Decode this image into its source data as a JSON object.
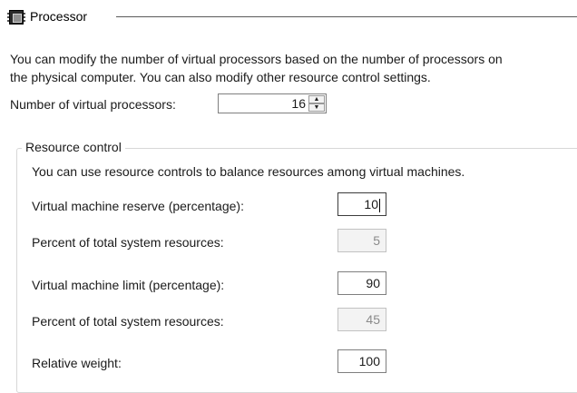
{
  "header": {
    "title": "Processor",
    "icon": "processor-chip-icon"
  },
  "description": {
    "line1": "You can modify the number of virtual processors based on the number of processors on",
    "line2": "the physical computer. You can also modify other resource control settings."
  },
  "virtual_processors": {
    "label": "Number of virtual processors:",
    "value": "16"
  },
  "resource_control": {
    "title": "Resource control",
    "description": "You can use resource controls to balance resources among virtual machines.",
    "reserve_label": "Virtual machine reserve (percentage):",
    "reserve_value": "10",
    "reserve_total_label": "Percent of total system resources:",
    "reserve_total_value": "5",
    "limit_label": "Virtual machine limit (percentage):",
    "limit_value": "90",
    "limit_total_label": "Percent of total system resources:",
    "limit_total_value": "45",
    "weight_label": "Relative weight:",
    "weight_value": "100"
  }
}
